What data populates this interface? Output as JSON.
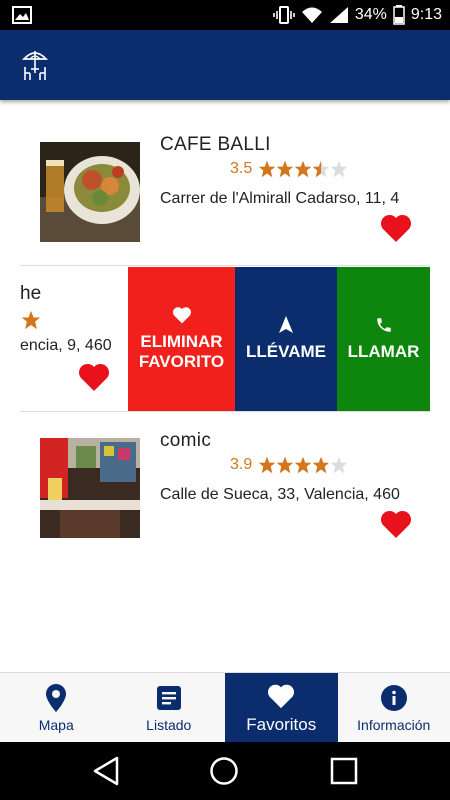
{
  "status_bar": {
    "battery": "34%",
    "time": "9:13"
  },
  "items": [
    {
      "name": "CAFE BALLI",
      "rating": "3.5",
      "rating_value": 3.5,
      "address": "Carrer de l'Almirall Cadarso, 11, 4"
    },
    {
      "name": "comic",
      "rating": "3.9",
      "rating_value": 3.9,
      "address": "Calle de Sueca, 33, Valencia, 460"
    }
  ],
  "swiped_item": {
    "name_partial": "he",
    "address_partial": "encia, 9, 460"
  },
  "actions": {
    "remove_line1": "ELIMINAR",
    "remove_line2": "FAVORITO",
    "go": "LLÉVAME",
    "call": "LLAMAR"
  },
  "bottom_nav": [
    {
      "label": "Mapa",
      "icon": "map-pin-icon"
    },
    {
      "label": "Listado",
      "icon": "list-icon"
    },
    {
      "label": "Favoritos",
      "icon": "heart-icon",
      "active": true
    },
    {
      "label": "Información",
      "icon": "info-icon"
    }
  ],
  "colors": {
    "primary": "#0b2d6e",
    "favorite": "#e8121c",
    "star": "#d4761c",
    "remove": "#f1201c",
    "call": "#0e860e"
  }
}
